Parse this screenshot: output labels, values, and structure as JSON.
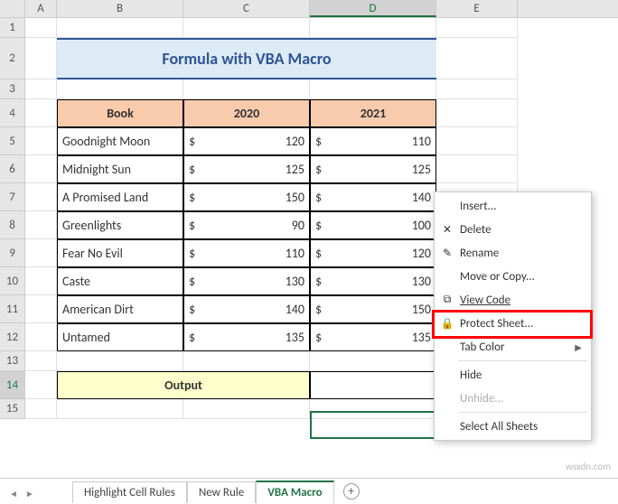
{
  "columns": [
    "A",
    "B",
    "C",
    "D",
    "E"
  ],
  "active_col": "D",
  "title": "Formula with VBA Macro",
  "headers": {
    "book": "Book",
    "y2020": "2020",
    "y2021": "2021"
  },
  "rows": [
    {
      "book": "Goodnight Moon",
      "v2020": "120",
      "v2021": "110"
    },
    {
      "book": "Midnight Sun",
      "v2020": "125",
      "v2021": "125"
    },
    {
      "book": "A Promised Land",
      "v2020": "150",
      "v2021": "140"
    },
    {
      "book": "Greenlights",
      "v2020": "90",
      "v2021": "100"
    },
    {
      "book": "Fear No Evil",
      "v2020": "110",
      "v2021": "120"
    },
    {
      "book": "Caste",
      "v2020": "130",
      "v2021": "130"
    },
    {
      "book": "American Dirt",
      "v2020": "140",
      "v2021": "150"
    },
    {
      "book": "Untamed",
      "v2020": "135",
      "v2021": "135"
    }
  ],
  "currency": "$",
  "output_label": "Output",
  "row_labels": [
    "1",
    "2",
    "3",
    "4",
    "5",
    "6",
    "7",
    "8",
    "9",
    "10",
    "11",
    "12",
    "13",
    "14",
    "15"
  ],
  "tabs": {
    "t1": "Highlight Cell Rules",
    "t2": "New Rule",
    "t3": "VBA Macro"
  },
  "context_menu": {
    "insert": "Insert...",
    "delete": "Delete",
    "rename": "Rename",
    "move": "Move or Copy...",
    "view_code": "View Code",
    "protect": "Protect Sheet...",
    "tab_color": "Tab Color",
    "hide": "Hide",
    "unhide": "Unhide...",
    "select_all": "Select All Sheets"
  },
  "watermark": "wsxdn.com"
}
